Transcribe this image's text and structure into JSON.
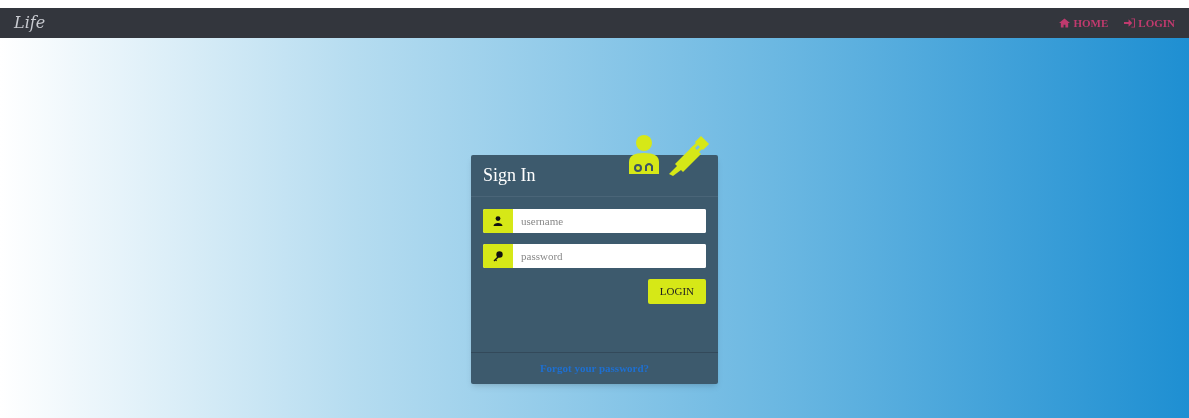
{
  "navbar": {
    "logo": "Life",
    "links": [
      {
        "kind": "home",
        "label": "HOME"
      },
      {
        "kind": "login",
        "label": "LOGIN"
      }
    ]
  },
  "sign_in": {
    "title": "Sign In",
    "fields": [
      {
        "kind": "user",
        "placeholder": "username"
      },
      {
        "kind": "key",
        "placeholder": "password"
      }
    ],
    "button": "LOGIN",
    "forgot_link": "Forgot your password?"
  }
}
